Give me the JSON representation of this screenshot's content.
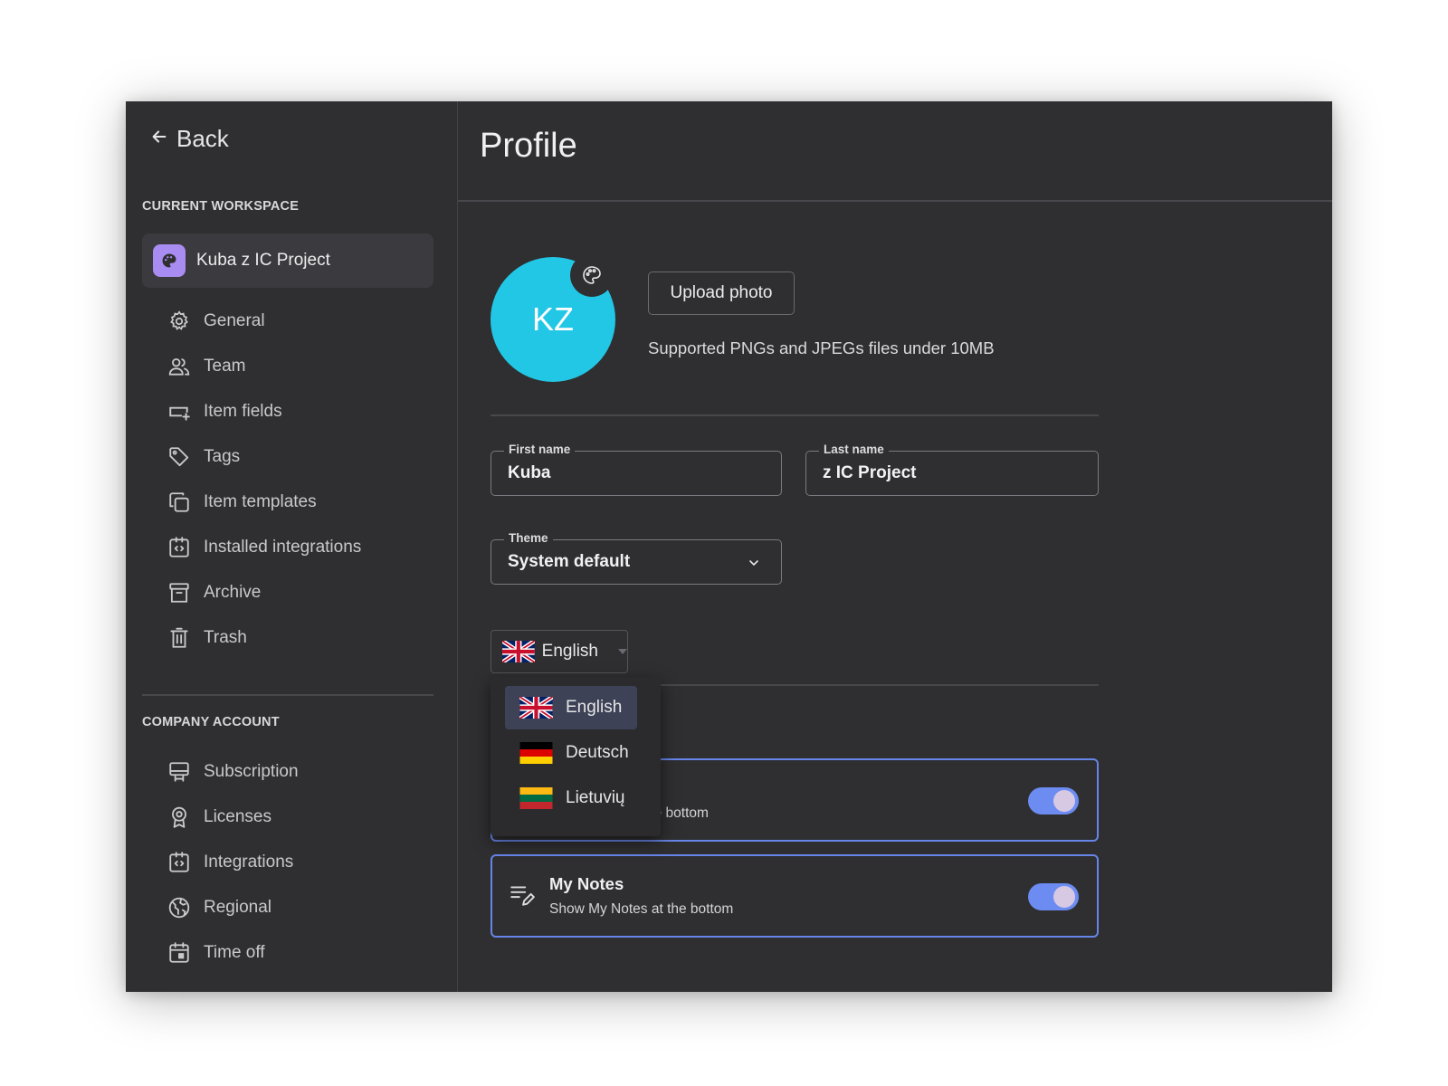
{
  "sidebar": {
    "back_label": "Back",
    "current_workspace_heading": "CURRENT WORKSPACE",
    "workspace_name": "Kuba z IC Project",
    "workspace_items": [
      {
        "label": "General",
        "icon": "gear-icon"
      },
      {
        "label": "Team",
        "icon": "team-icon"
      },
      {
        "label": "Item fields",
        "icon": "item-fields-icon"
      },
      {
        "label": "Tags",
        "icon": "tag-icon"
      },
      {
        "label": "Item templates",
        "icon": "templates-icon"
      },
      {
        "label": "Installed integrations",
        "icon": "integrations-icon"
      },
      {
        "label": "Archive",
        "icon": "archive-icon"
      },
      {
        "label": "Trash",
        "icon": "trash-icon"
      }
    ],
    "company_account_heading": "COMPANY ACCOUNT",
    "company_items": [
      {
        "label": "Subscription",
        "icon": "subscription-icon"
      },
      {
        "label": "Licenses",
        "icon": "license-icon"
      },
      {
        "label": "Integrations",
        "icon": "integrations-icon"
      },
      {
        "label": "Regional",
        "icon": "globe-icon"
      },
      {
        "label": "Time off",
        "icon": "calendar-icon"
      }
    ]
  },
  "profile": {
    "title": "Profile",
    "avatar_initials": "KZ",
    "upload_label": "Upload photo",
    "upload_hint": "Supported PNGs and JPEGs files under 10MB",
    "first_name_label": "First name",
    "first_name_value": "Kuba",
    "last_name_label": "Last name",
    "last_name_value": "z IC Project",
    "theme_label": "Theme",
    "theme_value": "System default",
    "language_value": "English"
  },
  "language_menu": {
    "options": [
      "English",
      "Deutsch",
      "Lietuvių"
    ],
    "selected": "English"
  },
  "cards": [
    {
      "title": "",
      "subtitle_visible_fragment": "ne bottom",
      "enabled": true
    },
    {
      "title": "My Notes",
      "subtitle": "Show My Notes at the bottom",
      "enabled": true
    }
  ],
  "colors": {
    "background": "#2f2f31",
    "avatar": "#22c7e6",
    "workspace_avatar": "#a98cf2",
    "accent_border": "#6785e8",
    "toggle_on": "#6c8cf2"
  }
}
